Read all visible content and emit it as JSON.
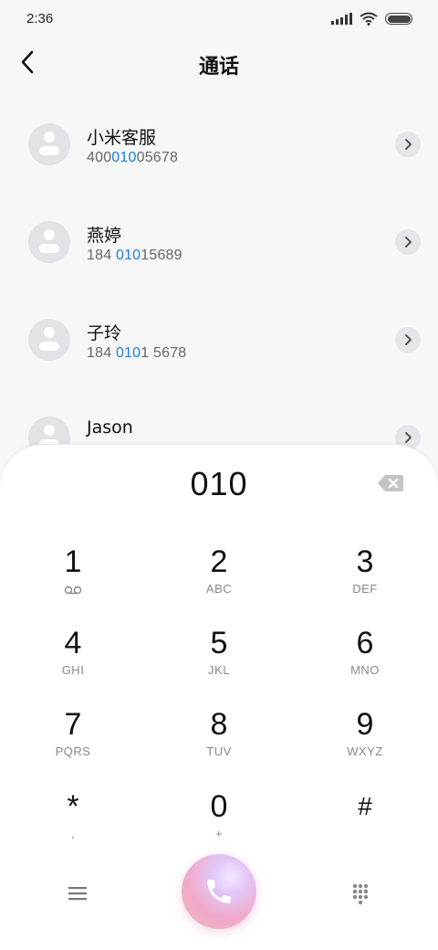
{
  "status_bar": {
    "time": "2:36"
  },
  "header": {
    "title": "通话"
  },
  "contacts": [
    {
      "name": "小米客服",
      "number_pre": "400",
      "number_match": "010",
      "number_post": "05678"
    },
    {
      "name": "燕婷",
      "number_pre": "184 ",
      "number_match": "010",
      "number_post": "15689"
    },
    {
      "name": "子玲",
      "number_pre": "184 ",
      "number_match": "010",
      "number_post": "1 5678"
    },
    {
      "name": "Jason",
      "number_pre": "",
      "number_match": "",
      "number_post": ""
    }
  ],
  "dialer": {
    "input_value": "010",
    "keys": [
      {
        "digit": "1",
        "letters": ""
      },
      {
        "digit": "2",
        "letters": "ABC"
      },
      {
        "digit": "3",
        "letters": "DEF"
      },
      {
        "digit": "4",
        "letters": "GHI"
      },
      {
        "digit": "5",
        "letters": "JKL"
      },
      {
        "digit": "6",
        "letters": "MNO"
      },
      {
        "digit": "7",
        "letters": "PQRS"
      },
      {
        "digit": "8",
        "letters": "TUV"
      },
      {
        "digit": "9",
        "letters": "WXYZ"
      },
      {
        "digit": "*",
        "letters": ","
      },
      {
        "digit": "0",
        "letters": "+"
      },
      {
        "digit": "#",
        "letters": ""
      }
    ]
  },
  "icons": {
    "back": "chevron-left-icon",
    "detail": "chevron-right-icon",
    "delete": "backspace-icon",
    "voicemail": "voicemail-icon",
    "menu": "menu-icon",
    "call": "phone-icon",
    "keypad": "keypad-icon"
  },
  "colors": {
    "highlight": "#1e7ee4",
    "avatar_bg": "#e1e3e7",
    "call_gradient": "#f1a9c9"
  }
}
